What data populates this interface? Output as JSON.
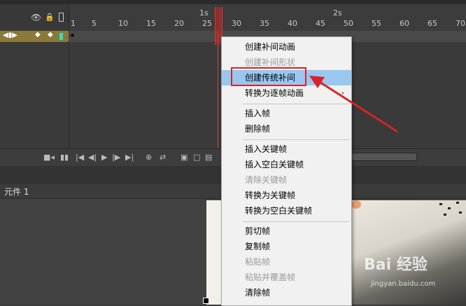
{
  "timeline": {
    "ruler_numbers": [
      "1",
      "5",
      "10",
      "15",
      "20",
      "25",
      "30",
      "35",
      "40",
      "45",
      "50",
      "55",
      "60",
      "65",
      "70"
    ],
    "second_labels": [
      "1s",
      "2s"
    ]
  },
  "controls": {
    "icons": [
      "camera-icon",
      "onion-icon",
      "first-frame-icon",
      "prev-frame-icon",
      "play-icon",
      "next-frame-icon",
      "last-frame-icon",
      "center-frame-icon",
      "loop-icon",
      "onion-skin-icon",
      "onion-outline-icon",
      "edit-multiple-icon",
      "marker-icon"
    ]
  },
  "symbol": {
    "label": "元件 1"
  },
  "context_menu": {
    "items": [
      {
        "label": "创建补间动画",
        "disabled": false
      },
      {
        "label": "创建补间形状",
        "disabled": true
      },
      {
        "label": "创建传统补间",
        "disabled": false,
        "highlighted": true
      },
      {
        "label": "转换为逐帧动画",
        "disabled": false,
        "submenu": true
      },
      {
        "label": "插入帧",
        "disabled": false
      },
      {
        "label": "删除帧",
        "disabled": false
      },
      {
        "label": "插入关键帧",
        "disabled": false
      },
      {
        "label": "插入空白关键帧",
        "disabled": false
      },
      {
        "label": "清除关键帧",
        "disabled": true
      },
      {
        "label": "转换为关键帧",
        "disabled": false
      },
      {
        "label": "转换为空白关键帧",
        "disabled": false
      },
      {
        "label": "剪切帧",
        "disabled": false
      },
      {
        "label": "复制帧",
        "disabled": false
      },
      {
        "label": "粘贴帧",
        "disabled": true
      },
      {
        "label": "粘贴并覆盖帧",
        "disabled": true
      },
      {
        "label": "清除帧",
        "disabled": false
      }
    ]
  },
  "watermark": {
    "brand": "Bai 经验",
    "url": "jingyan.baidu.com"
  },
  "colors": {
    "highlight": "#99c7f0",
    "annotation": "#d8232a",
    "layer": "#8a7a3a"
  }
}
